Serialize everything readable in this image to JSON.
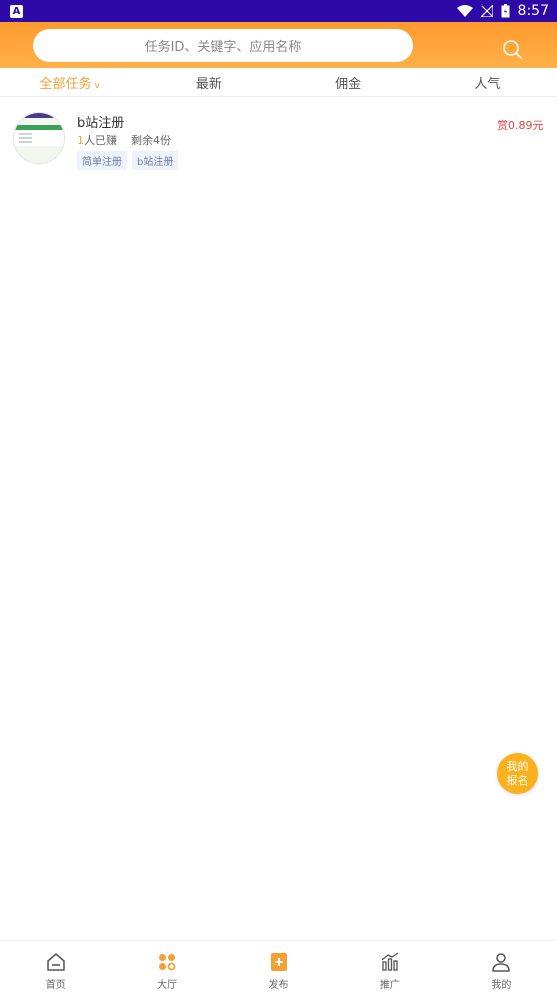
{
  "statusbar": {
    "app_badge": "A",
    "time": "8:57"
  },
  "search": {
    "placeholder": "任务ID、关键字、应用名称"
  },
  "tabs": [
    {
      "label": "全部任务",
      "caret": "v"
    },
    {
      "label": "最新"
    },
    {
      "label": "佣金"
    },
    {
      "label": "人气"
    }
  ],
  "task": {
    "title": "b站注册",
    "joined_count": "1",
    "joined_suffix": "人已赚",
    "remaining": "剩余4份",
    "tags": [
      "简单注册",
      "b站注册"
    ],
    "reward": "赏0.89元"
  },
  "fab": {
    "line1": "我的",
    "line2": "报名"
  },
  "nav": [
    {
      "label": "首页",
      "icon": "home-icon"
    },
    {
      "label": "大厅",
      "icon": "hall-icon"
    },
    {
      "label": "发布",
      "icon": "publish-icon"
    },
    {
      "label": "推广",
      "icon": "promote-icon"
    },
    {
      "label": "我的",
      "icon": "profile-icon"
    }
  ],
  "colors": {
    "accent": "#f5a034",
    "reward": "#e8453c",
    "statusbar": "#2d0aa8"
  }
}
